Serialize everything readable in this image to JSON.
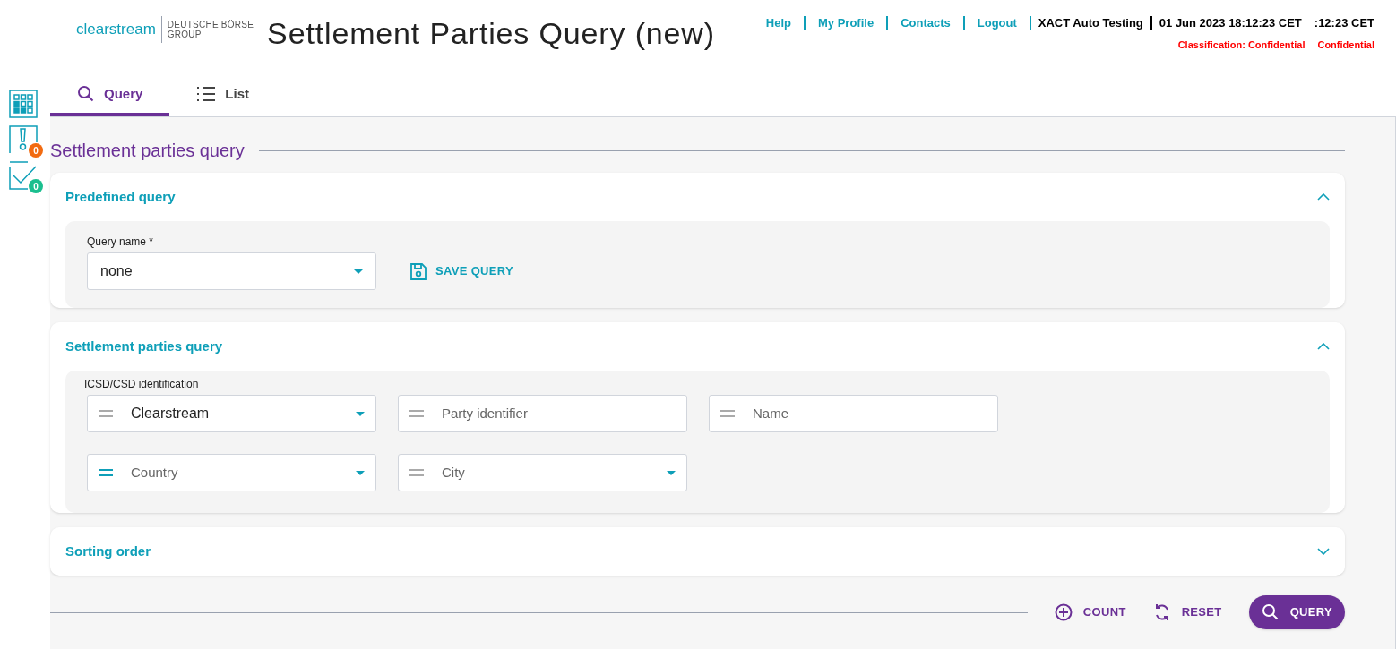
{
  "header": {
    "logo_brand": "clearstream",
    "logo_group_line1": "DEUTSCHE BÖRSE",
    "logo_group_line2": "GROUP",
    "title": "Settlement Parties Query (new)",
    "links": [
      "Help",
      "My Profile",
      "Contacts",
      "Logout"
    ],
    "user": "XACT Auto Testing",
    "datetime": "01 Jun 2023 18:12:23 CET",
    "time_short": ":12:23 CET",
    "classification": "Classification: Confidential",
    "classification_short": "Confidential"
  },
  "side_icons": [
    {
      "kind": "apps"
    },
    {
      "kind": "alert",
      "badge": "0"
    },
    {
      "kind": "tasks",
      "badge": "0"
    }
  ],
  "tabs": [
    {
      "label": "Query",
      "kind": "search",
      "selected": true
    },
    {
      "label": "List",
      "kind": "list",
      "selected": false
    }
  ],
  "page_heading": "Settlement parties query",
  "sections": [
    {
      "title": "Predefined query",
      "expanded": true,
      "kind": "predefined",
      "label": "Query name *",
      "select_value": "none",
      "action": "SAVE QUERY"
    },
    {
      "title": "Settlement parties query",
      "expanded": true,
      "kind": "fields",
      "label": "ICSD/CSD identification",
      "rows": [
        [
          {
            "kind": "select",
            "value": "Clearstream",
            "operator_active": false
          },
          {
            "kind": "text",
            "placeholder": "Party identifier",
            "operator_active": false
          },
          {
            "kind": "text",
            "placeholder": "Name",
            "operator_active": false
          }
        ],
        [
          {
            "kind": "select",
            "placeholder": "Country",
            "operator_active": true
          },
          {
            "kind": "select",
            "placeholder": "City",
            "operator_active": false
          }
        ]
      ]
    },
    {
      "title": "Sorting order",
      "expanded": false
    }
  ],
  "footer_buttons": [
    {
      "label": "COUNT",
      "kind": "count"
    },
    {
      "label": "RESET",
      "kind": "reset"
    },
    {
      "label": "QUERY",
      "kind": "query"
    }
  ]
}
